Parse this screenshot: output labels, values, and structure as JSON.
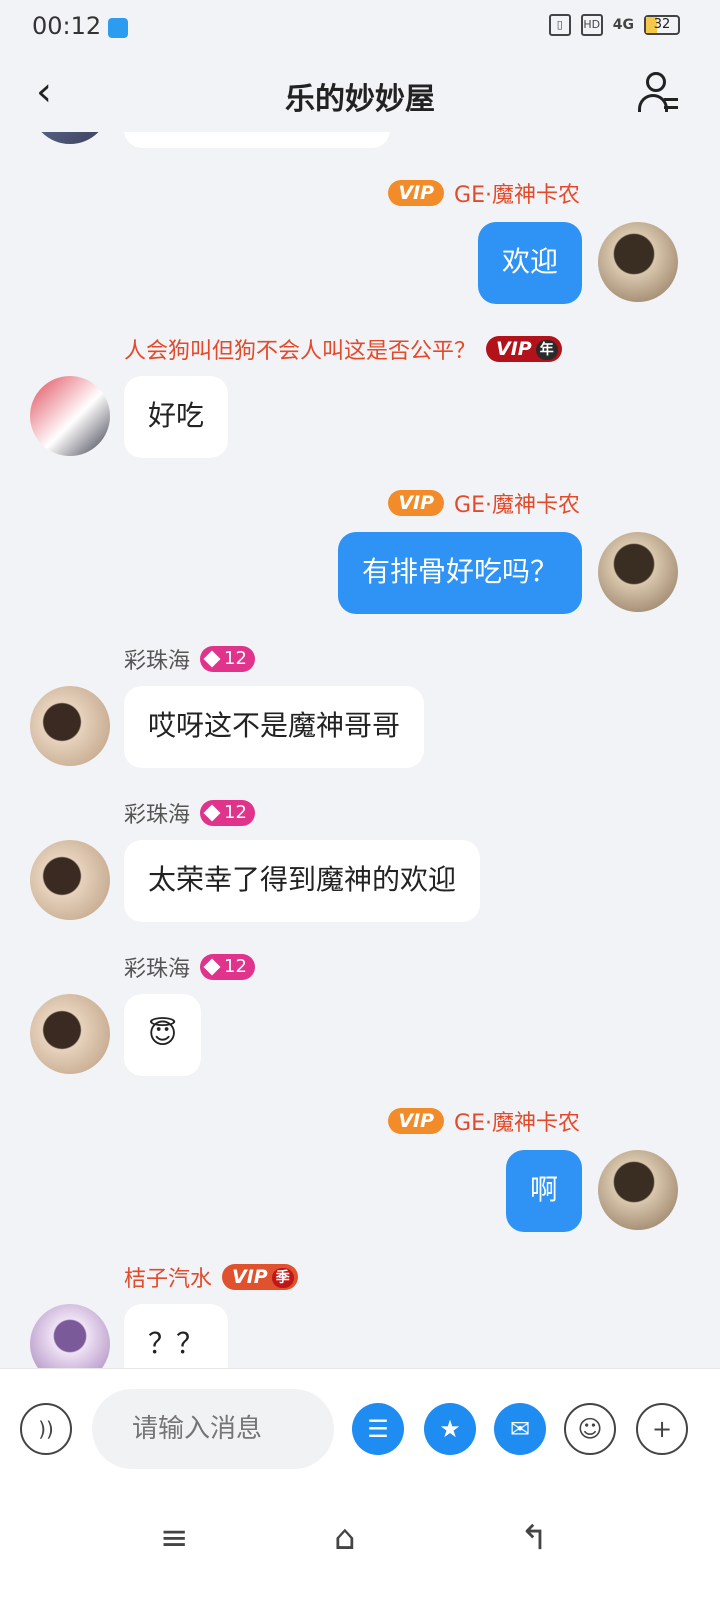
{
  "status_bar": {
    "time": "00:12",
    "hd": "HD",
    "network": "4G",
    "battery": "32"
  },
  "header": {
    "title": "乐的妙妙屋"
  },
  "messages": [
    {
      "side": "right",
      "name": "GE·魔神卡农",
      "vip": "VIP",
      "text": "欢迎"
    },
    {
      "side": "left",
      "name": "人会狗叫但狗不会人叫这是否公平？",
      "vip": "VIP",
      "vip_tag": "年",
      "text": "好吃"
    },
    {
      "side": "right",
      "name": "GE·魔神卡农",
      "vip": "VIP",
      "text": "有排骨好吃吗？"
    },
    {
      "side": "left",
      "name": "彩珠海",
      "level": "12",
      "text": "哎呀这不是魔神哥哥"
    },
    {
      "side": "left",
      "name": "彩珠海",
      "level": "12",
      "text": "太荣幸了得到魔神的欢迎"
    },
    {
      "side": "left",
      "name": "彩珠海",
      "level": "12",
      "text": "😇"
    },
    {
      "side": "right",
      "name": "GE·魔神卡农",
      "vip": "VIP",
      "text": "啊"
    },
    {
      "side": "left",
      "name": "桔子汽水",
      "vip": "VIP",
      "vip_tag": "季",
      "text": "？？"
    }
  ],
  "input": {
    "placeholder": "请输入消息"
  },
  "icons": {
    "voice": "voice-icon",
    "gift": "gift-icon",
    "trophy": "trophy-icon",
    "red_packet": "red-packet-icon",
    "emoji": "emoji-icon",
    "plus": "plus-icon"
  },
  "colors": {
    "accent": "#2f93f5",
    "name_red": "#e34a2a",
    "vip_orange": "#f28c2a"
  }
}
